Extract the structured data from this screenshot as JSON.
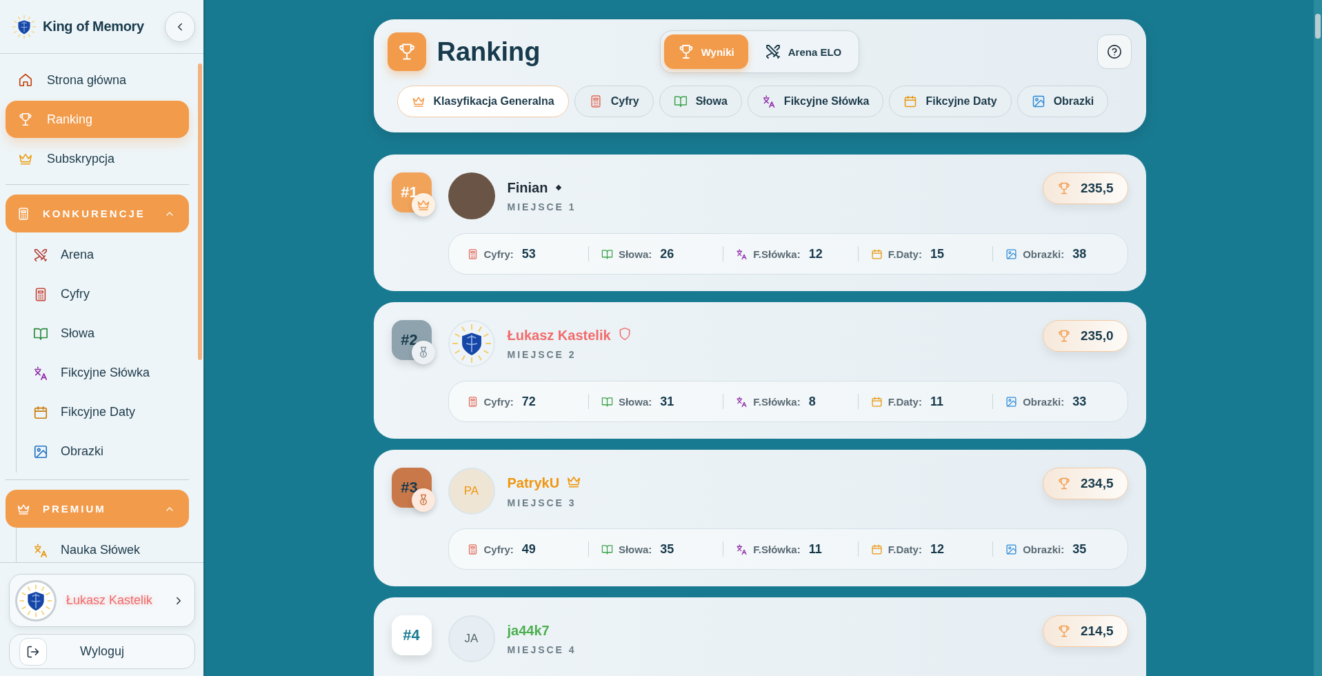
{
  "sidebar": {
    "brand": "King of Memory",
    "nav": [
      {
        "label": "Strona główna",
        "selected": false
      },
      {
        "label": "Ranking",
        "selected": true
      },
      {
        "label": "Subskrypcja",
        "selected": false
      }
    ],
    "groups": [
      {
        "title": "KONKURENCJE",
        "expanded": true,
        "items": [
          {
            "label": "Arena"
          },
          {
            "label": "Cyfry"
          },
          {
            "label": "Słowa"
          },
          {
            "label": "Fikcyjne Słówka"
          },
          {
            "label": "Fikcyjne Daty"
          },
          {
            "label": "Obrazki"
          }
        ]
      },
      {
        "title": "PREMIUM",
        "expanded": true,
        "items": [
          {
            "label": "Nauka Słówek"
          }
        ]
      }
    ],
    "user": {
      "name": "Łukasz Kastelik"
    },
    "logout": "Wyloguj"
  },
  "header": {
    "title": "Ranking",
    "modes": [
      {
        "label": "Wyniki",
        "selected": true
      },
      {
        "label": "Arena ELO",
        "selected": false
      }
    ],
    "categories": [
      {
        "label": "Klasyfikacja Generalna",
        "selected": true
      },
      {
        "label": "Cyfry",
        "selected": false
      },
      {
        "label": "Słowa",
        "selected": false
      },
      {
        "label": "Fikcyjne Słówka",
        "selected": false
      },
      {
        "label": "Fikcyjne Daty",
        "selected": false
      },
      {
        "label": "Obrazki",
        "selected": false
      }
    ]
  },
  "players": [
    {
      "rank": "#1",
      "kind": "diamond",
      "name": "Finian",
      "color": "#1c2b36",
      "place": "MIEJSCE 1",
      "score": "235,5",
      "stats": [
        {
          "label": "Cyfry:",
          "value": "53"
        },
        {
          "label": "Słowa:",
          "value": "26"
        },
        {
          "label": "F.Słówka:",
          "value": "12"
        },
        {
          "label": "F.Daty:",
          "value": "15"
        },
        {
          "label": "Obrazki:",
          "value": "38"
        }
      ]
    },
    {
      "rank": "#2",
      "kind": "shield",
      "name": "Łukasz Kastelik",
      "color": "#f26b6b",
      "place": "MIEJSCE 2",
      "score": "235,0",
      "stats": [
        {
          "label": "Cyfry:",
          "value": "72"
        },
        {
          "label": "Słowa:",
          "value": "31"
        },
        {
          "label": "F.Słówka:",
          "value": "8"
        },
        {
          "label": "F.Daty:",
          "value": "11"
        },
        {
          "label": "Obrazki:",
          "value": "33"
        }
      ]
    },
    {
      "rank": "#3",
      "kind": "crown",
      "initials": "PA",
      "name": "PatrykU",
      "color": "#f0960f",
      "place": "MIEJSCE 3",
      "score": "234,5",
      "stats": [
        {
          "label": "Cyfry:",
          "value": "49"
        },
        {
          "label": "Słowa:",
          "value": "35"
        },
        {
          "label": "F.Słówka:",
          "value": "11"
        },
        {
          "label": "F.Daty:",
          "value": "12"
        },
        {
          "label": "Obrazki:",
          "value": "35"
        }
      ]
    },
    {
      "rank": "#4",
      "kind": "plain",
      "initials": "JA",
      "name": "ja44k7",
      "color": "#4caf50",
      "place": "MIEJSCE 4",
      "score": "214,5"
    }
  ]
}
